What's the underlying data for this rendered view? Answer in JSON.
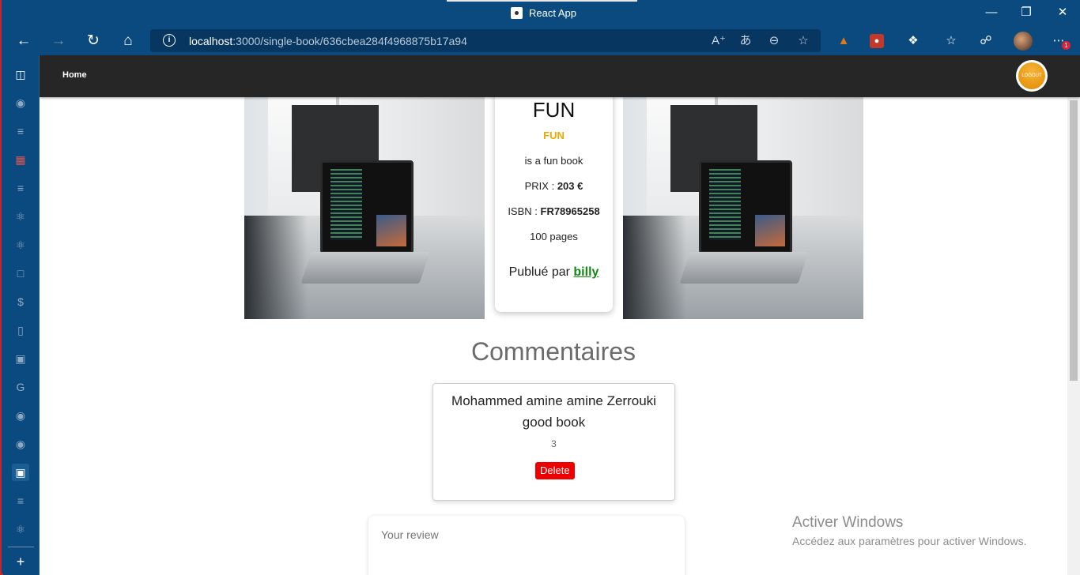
{
  "window": {
    "title": "React App"
  },
  "browser": {
    "url_host": "localhost",
    "url_rest": ":3000/single-book/636cbea284f4968875b17a94",
    "notification_count": "1"
  },
  "app": {
    "nav_home": "Home",
    "logout_label": "LOGOUT"
  },
  "book": {
    "title": "FUN",
    "category": "FUN",
    "description": "is a fun book",
    "price_label": "PRIX : ",
    "price_value": "203 €",
    "isbn_label": "ISBN : ",
    "isbn_value": "FR78965258",
    "pages": "100 pages",
    "published_by_label": "Publué par ",
    "publisher": "billy"
  },
  "comments": {
    "heading": "Commentaires",
    "items": [
      {
        "author": "Mohammed amine amine Zerrouki",
        "text": "good book",
        "rating": "3",
        "delete_label": "Delete"
      }
    ]
  },
  "review": {
    "placeholder": "Your review"
  },
  "watermark": {
    "heading": "Activer Windows",
    "subtext": "Accédez aux paramètres pour activer Windows."
  }
}
